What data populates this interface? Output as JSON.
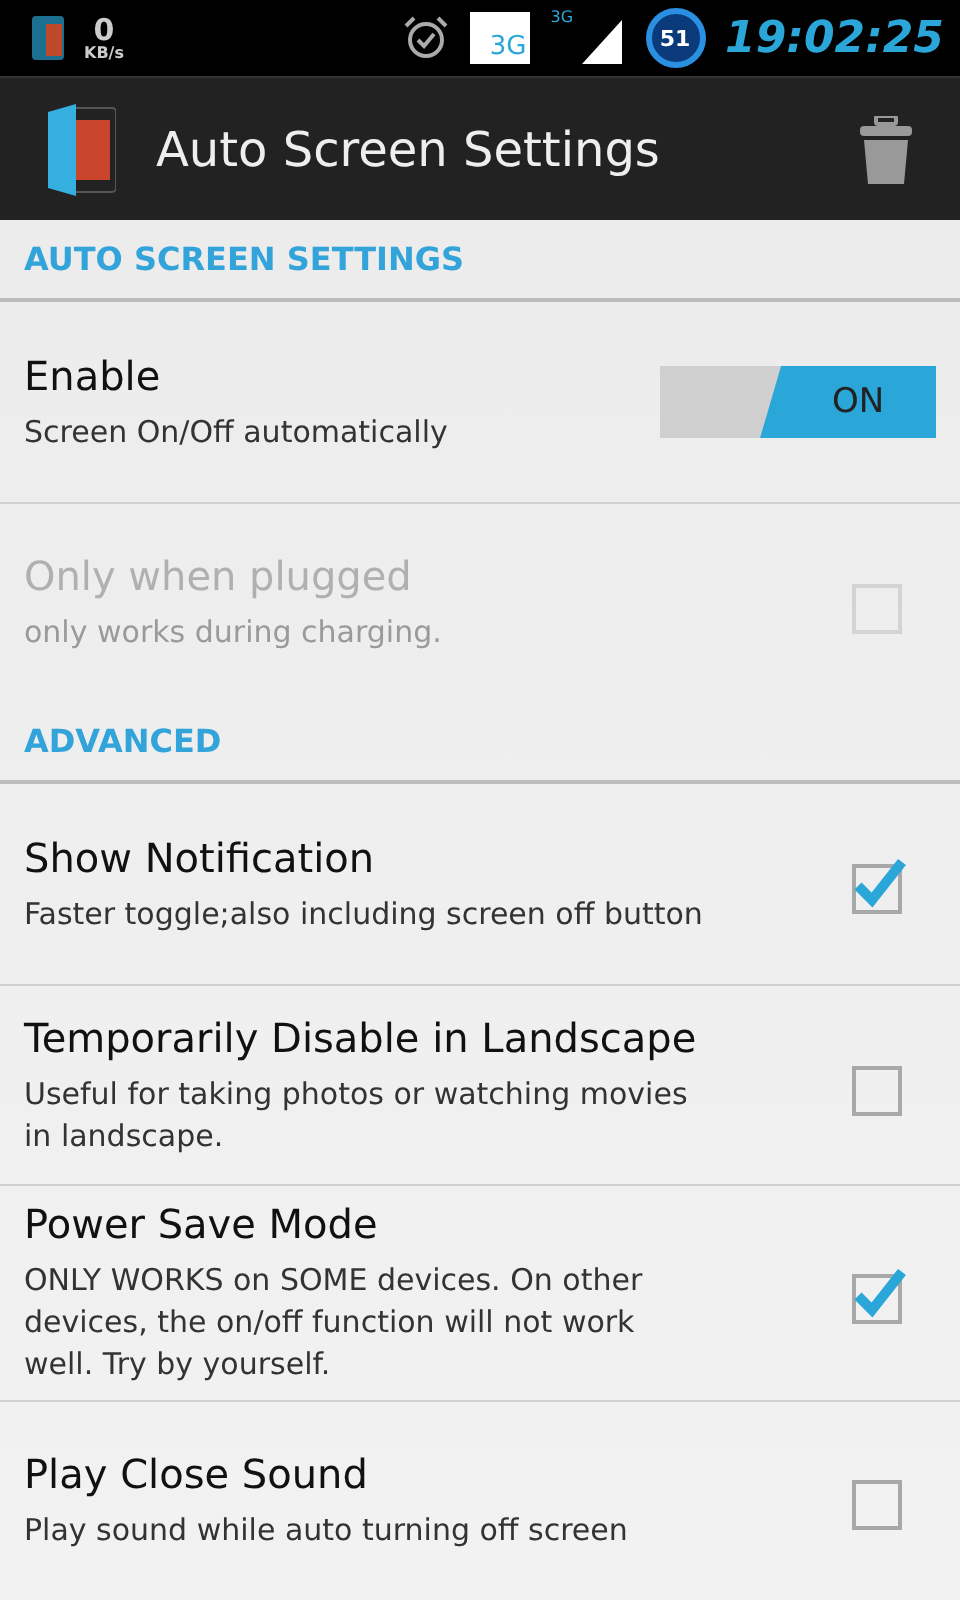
{
  "status_bar": {
    "data_rate": "0",
    "data_unit": "KB/s",
    "network_badge": "3G",
    "network_type": "3G",
    "battery_badge": "51",
    "time": "19:02:25"
  },
  "action_bar": {
    "title": "Auto Screen Settings"
  },
  "sections": [
    {
      "header": "AUTO SCREEN SETTINGS",
      "items": [
        {
          "kind": "switch",
          "title": "Enable",
          "summary": "Screen On/Off automatically",
          "on": true,
          "switch_label": "ON",
          "disabled": false
        },
        {
          "kind": "checkbox",
          "title": "Only when plugged",
          "summary": "only works during charging.",
          "checked": false,
          "disabled": true
        }
      ]
    },
    {
      "header": "ADVANCED",
      "items": [
        {
          "kind": "checkbox",
          "title": "Show Notification",
          "summary": "Faster toggle;also including screen off button",
          "checked": true,
          "disabled": false
        },
        {
          "kind": "checkbox",
          "title": "Temporarily Disable in Landscape",
          "summary": "Useful for taking photos or watching movies in landscape.",
          "checked": false,
          "disabled": false
        },
        {
          "kind": "checkbox",
          "title": "Power Save Mode",
          "summary": "ONLY WORKS on SOME devices. On other devices, the on/off function will not work well. Try by yourself.",
          "checked": true,
          "disabled": false
        },
        {
          "kind": "checkbox",
          "title": "Play Close Sound",
          "summary": "Play sound while auto turning off screen",
          "checked": false,
          "disabled": false
        }
      ]
    }
  ]
}
